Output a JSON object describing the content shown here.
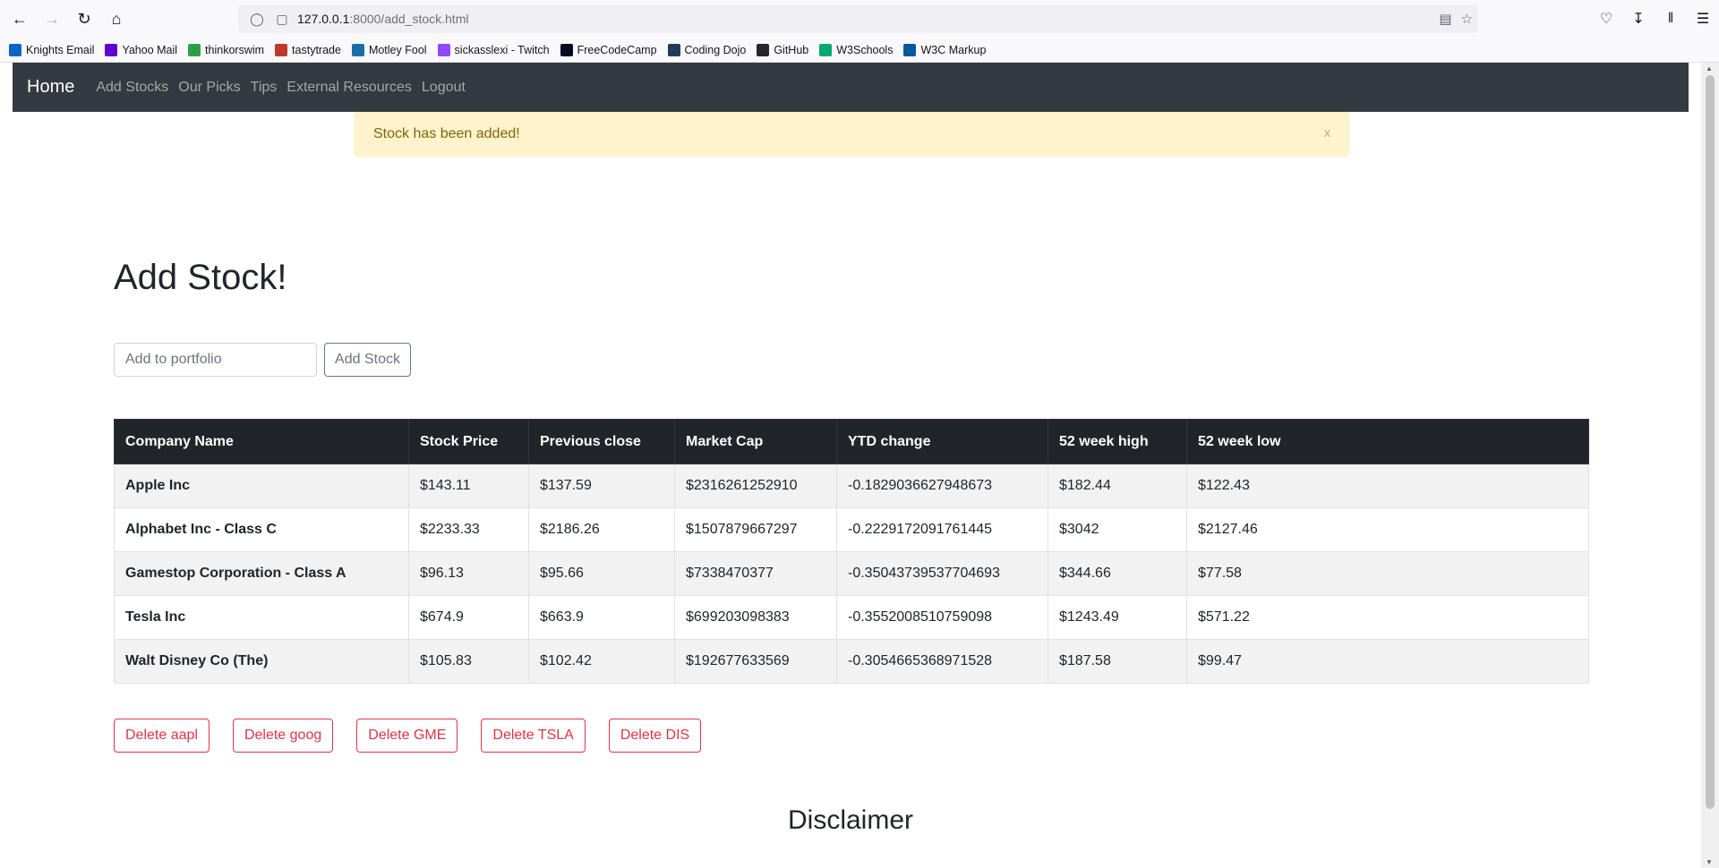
{
  "browser": {
    "url_host": "127.0.0.1",
    "url_path": ":8000/add_stock.html",
    "bookmarks": [
      {
        "label": "Knights Email",
        "color": "#0a66c2"
      },
      {
        "label": "Yahoo Mail",
        "color": "#6001d2"
      },
      {
        "label": "thinkorswim",
        "color": "#2ea043"
      },
      {
        "label": "tastytrade",
        "color": "#c0392b"
      },
      {
        "label": "Motley Fool",
        "color": "#1b6fa8"
      },
      {
        "label": "sickasslexi - Twitch",
        "color": "#9146ff"
      },
      {
        "label": "FreeCodeCamp",
        "color": "#0a0a23"
      },
      {
        "label": "Coding Dojo",
        "color": "#1f3a5a"
      },
      {
        "label": "GitHub",
        "color": "#24292e"
      },
      {
        "label": "W3Schools",
        "color": "#04aa6d"
      },
      {
        "label": "W3C Markup",
        "color": "#005a9c"
      }
    ]
  },
  "navbar": {
    "brand": "Home",
    "links": [
      "Add Stocks",
      "Our Picks",
      "Tips",
      "External Resources",
      "Logout"
    ]
  },
  "alert": {
    "message": "Stock has been added!",
    "close": "x"
  },
  "main": {
    "title": "Add Stock!",
    "input_placeholder": "Add to portfolio",
    "add_button": "Add Stock"
  },
  "table": {
    "headers": [
      "Company Name",
      "Stock Price",
      "Previous close",
      "Market Cap",
      "YTD change",
      "52 week high",
      "52 week low"
    ],
    "rows": [
      [
        "Apple Inc",
        "$143.11",
        "$137.59",
        "$2316261252910",
        "-0.1829036627948673",
        "$182.44",
        "$122.43"
      ],
      [
        "Alphabet Inc - Class C",
        "$2233.33",
        "$2186.26",
        "$1507879667297",
        "-0.2229172091761445",
        "$3042",
        "$2127.46"
      ],
      [
        "Gamestop Corporation - Class A",
        "$96.13",
        "$95.66",
        "$7338470377",
        "-0.35043739537704693",
        "$344.66",
        "$77.58"
      ],
      [
        "Tesla Inc",
        "$674.9",
        "$663.9",
        "$699203098383",
        "-0.3552008510759098",
        "$1243.49",
        "$571.22"
      ],
      [
        "Walt Disney Co (The)",
        "$105.83",
        "$102.42",
        "$192677633569",
        "-0.3054665368971528",
        "$187.58",
        "$99.47"
      ]
    ]
  },
  "delete_buttons": [
    "Delete aapl",
    "Delete goog",
    "Delete GME",
    "Delete TSLA",
    "Delete DIS"
  ],
  "footer": {
    "disclaimer": "Disclaimer"
  }
}
